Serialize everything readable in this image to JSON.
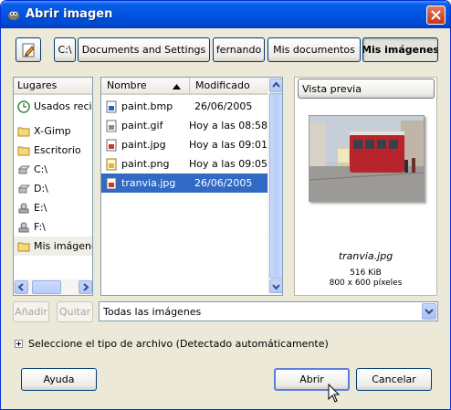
{
  "window": {
    "title": "Abrir imagen"
  },
  "path_bar": {
    "crumbs": [
      "C:\\",
      "Documents and Settings",
      "fernando",
      "Mis documentos",
      "Mis imágenes"
    ]
  },
  "places": {
    "header": "Lugares",
    "items": [
      {
        "label": "Usados recien",
        "icon": "recent-icon"
      },
      {
        "label": "X-Gimp",
        "icon": "folder-icon"
      },
      {
        "label": "Escritorio",
        "icon": "folder-icon"
      },
      {
        "label": "C:\\",
        "icon": "drive-icon"
      },
      {
        "label": "D:\\",
        "icon": "drive-icon"
      },
      {
        "label": "E:\\",
        "icon": "removable-drive-icon"
      },
      {
        "label": "F:\\",
        "icon": "removable-drive-icon"
      },
      {
        "label": "Mis imágenes",
        "icon": "folder-icon"
      }
    ],
    "add_label": "Añadir",
    "remove_label": "Quitar"
  },
  "files": {
    "col_name": "Nombre",
    "col_modified": "Modificado",
    "rows": [
      {
        "name": "paint.bmp",
        "modified": "26/06/2005",
        "icon": "bmp-file-icon"
      },
      {
        "name": "paint.gif",
        "modified": "Hoy a las 08:58",
        "icon": "gif-file-icon"
      },
      {
        "name": "paint.jpg",
        "modified": "Hoy a las 09:01",
        "icon": "jpg-file-icon"
      },
      {
        "name": "paint.png",
        "modified": "Hoy a las 09:05",
        "icon": "png-file-icon"
      },
      {
        "name": "tranvia.jpg",
        "modified": "26/06/2005",
        "icon": "jpg-file-icon",
        "selected": true
      }
    ]
  },
  "preview": {
    "title": "Vista previa",
    "filename": "tranvia.jpg",
    "size": "516 KiB",
    "dimensions": "800 x 600 píxeles"
  },
  "filter": {
    "selected": "Todas las imágenes"
  },
  "file_type_expander": "Seleccione el tipo de archivo (Detectado automáticamente)",
  "buttons": {
    "help": "Ayuda",
    "open": "Abrir",
    "cancel": "Cancelar"
  },
  "colors": {
    "accent": "#316ac5",
    "titlebar": "#0054e3"
  }
}
